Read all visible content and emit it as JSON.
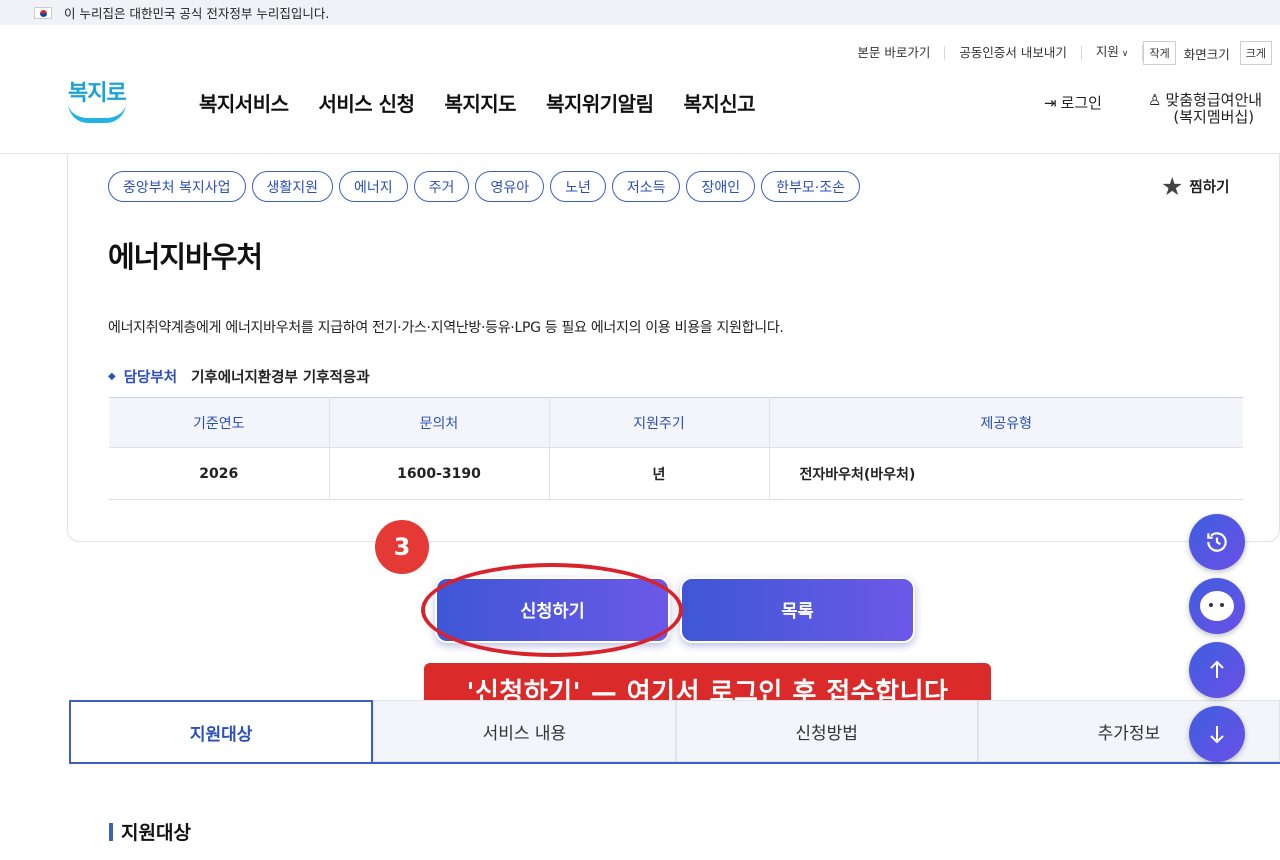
{
  "gov_banner": {
    "text": "이 누리집은 대한민국 공식 전자정부 누리집입니다."
  },
  "util": {
    "skip": "본문 바로가기",
    "cert": "공동인증서 내보내기",
    "support": "지원",
    "small": "작게",
    "size": "화면크기",
    "large": "크게"
  },
  "logo": {
    "text": "복지로"
  },
  "gnb": [
    "복지서비스",
    "서비스 신청",
    "복지지도",
    "복지위기알림",
    "복지신고"
  ],
  "account": {
    "login": "로그인",
    "member_1": "맞춤형급여안내",
    "member_2": "(복지멤버십)"
  },
  "tags": [
    "중앙부처 복지사업",
    "생활지원",
    "에너지",
    "주거",
    "영유아",
    "노년",
    "저소득",
    "장애인",
    "한부모·조손"
  ],
  "wish": "찜하기",
  "service": {
    "title": "에너지바우처",
    "description": "에너지취약계층에게 에너지바우처를 지급하여 전기·가스·지역난방·등유·LPG 등 필요 에너지의 이용 비용을 지원합니다.",
    "dept_label": "담당부처",
    "dept_value": "기후에너지환경부 기후적응과"
  },
  "table": {
    "headers": [
      "기준연도",
      "문의처",
      "지원주기",
      "제공유형"
    ],
    "row": [
      "2026",
      "1600-3190",
      "년",
      "전자바우처(바우처)"
    ]
  },
  "buttons": {
    "apply": "신청하기",
    "list": "목록"
  },
  "annotation": {
    "step": "3",
    "callout": "'신청하기' — 여기서 로그인 후 접수합니다"
  },
  "tabs": [
    "지원대상",
    "서비스 내용",
    "신청방법",
    "추가정보"
  ],
  "section_title": "지원대상",
  "colors": {
    "primary": "#3d5fc5",
    "accent_red": "#db2a2a"
  }
}
